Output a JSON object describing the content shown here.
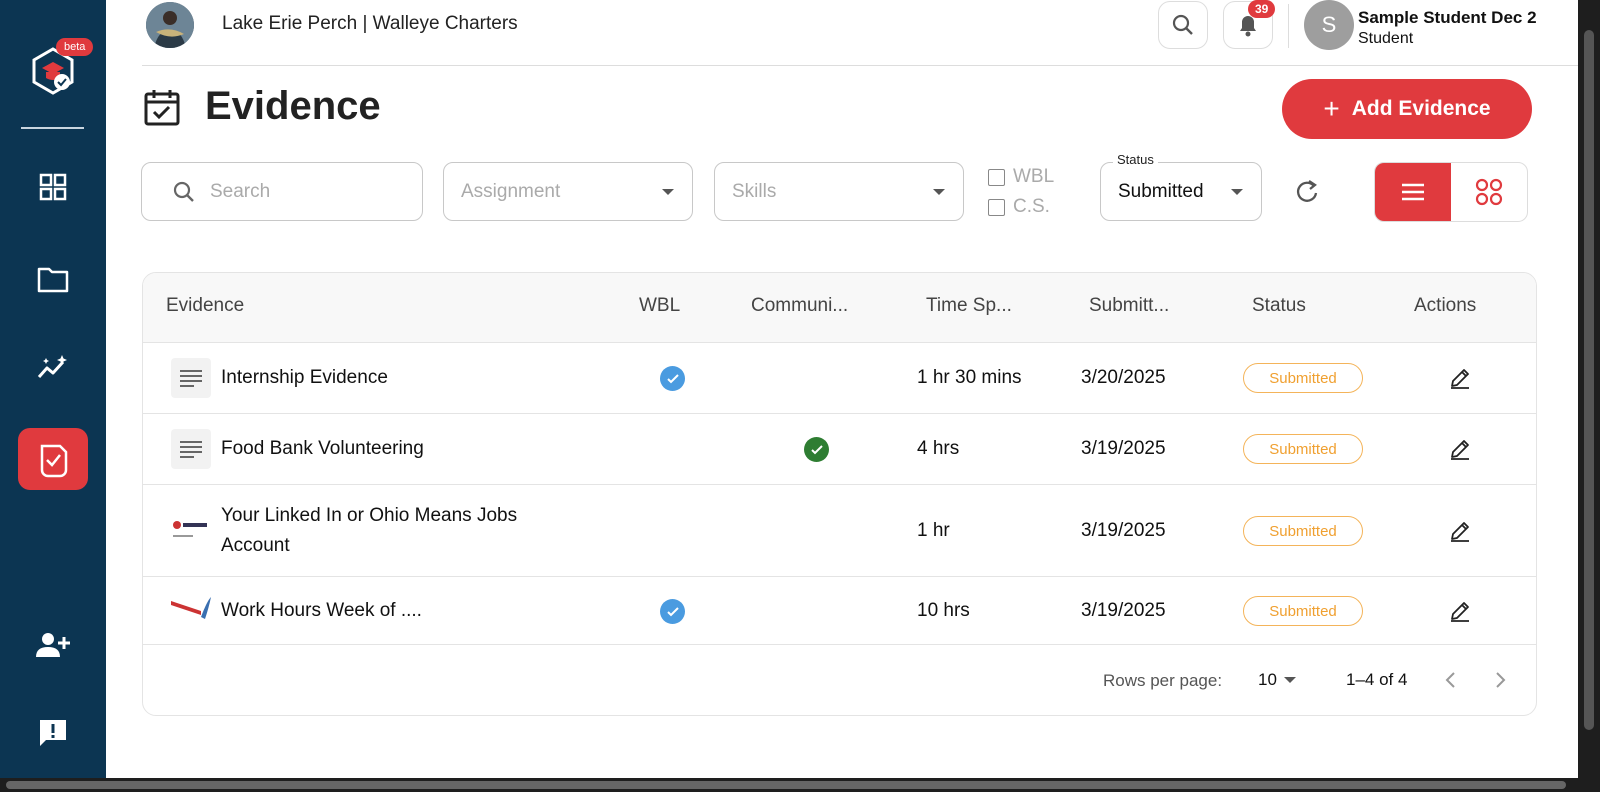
{
  "sidebar": {
    "badge": "beta",
    "items": [
      {
        "name": "dashboard",
        "icon": "grid-icon"
      },
      {
        "name": "portfolio",
        "icon": "folder-icon"
      },
      {
        "name": "skills",
        "icon": "trend-sparkle-icon"
      },
      {
        "name": "evidence",
        "icon": "evidence-check-icon",
        "active": true
      },
      {
        "name": "add-user",
        "icon": "user-plus-icon"
      },
      {
        "name": "feedback",
        "icon": "feedback-icon"
      }
    ]
  },
  "header": {
    "org_name": "Lake Erie Perch | Walleye Charters",
    "notification_count": "39",
    "user": {
      "initial": "S",
      "name": "Sample Student Dec 2",
      "role": "Student"
    }
  },
  "page": {
    "title": "Evidence",
    "add_button": "Add Evidence"
  },
  "filters": {
    "search_placeholder": "Search",
    "assignment_placeholder": "Assignment",
    "skills_placeholder": "Skills",
    "wbl_label": "WBL",
    "cs_label": "C.S.",
    "status_label": "Status",
    "status_value": "Submitted"
  },
  "table": {
    "columns": [
      "Evidence",
      "WBL",
      "Communi...",
      "Time Sp...",
      "Submitt...",
      "Status",
      "Actions"
    ],
    "rows": [
      {
        "name": "Internship Evidence",
        "thumb": "document-icon",
        "wbl": true,
        "community": false,
        "time": "1 hr 30 mins",
        "submitted": "3/20/2025",
        "status": "Submitted"
      },
      {
        "name": "Food Bank Volunteering",
        "thumb": "document-icon",
        "wbl": false,
        "community": true,
        "time": "4 hrs",
        "submitted": "3/19/2025",
        "status": "Submitted"
      },
      {
        "name": "Your Linked In or Ohio Means Jobs Account",
        "thumb": "image",
        "wbl": false,
        "community": false,
        "time": "1 hr",
        "submitted": "3/19/2025",
        "status": "Submitted"
      },
      {
        "name": "Work Hours Week of ....",
        "thumb": "image",
        "wbl": true,
        "community": false,
        "time": "10 hrs",
        "submitted": "3/19/2025",
        "status": "Submitted"
      }
    ],
    "footer": {
      "rows_per_page_label": "Rows per page:",
      "rows_per_page": "10",
      "range": "1–4 of 4"
    }
  },
  "colors": {
    "sidebar": "#0c3552",
    "accent": "#e03a3e",
    "wbl_check": "#4a9be0",
    "community_check": "#2e7d32",
    "status_badge": "#f0a030"
  }
}
